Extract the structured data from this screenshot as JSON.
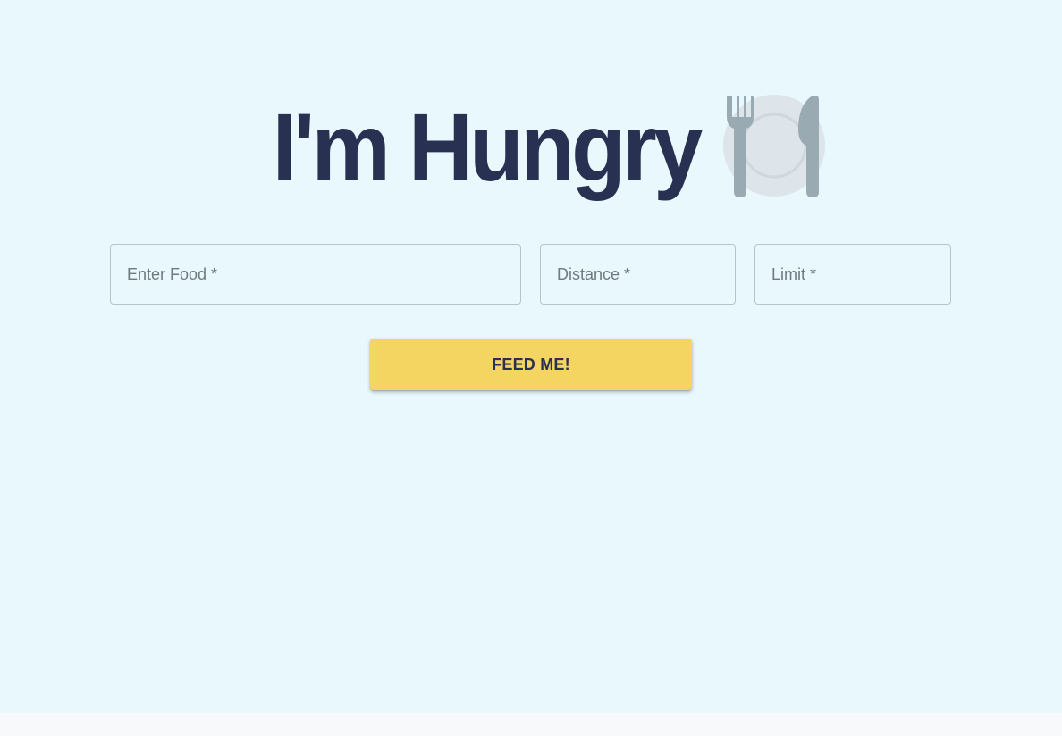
{
  "header": {
    "title": "I'm Hungry",
    "icon": "fork-knife-plate-icon"
  },
  "form": {
    "food_placeholder": "Enter Food *",
    "food_value": "",
    "distance_placeholder": "Distance *",
    "distance_value": "",
    "limit_placeholder": "Limit *",
    "limit_value": "",
    "submit_label": "FEED ME!"
  },
  "colors": {
    "background": "#e8f8fc",
    "title": "#283152",
    "button": "#f4d562",
    "icon": "#9aaab2",
    "field_border": "#b8c4c9"
  }
}
